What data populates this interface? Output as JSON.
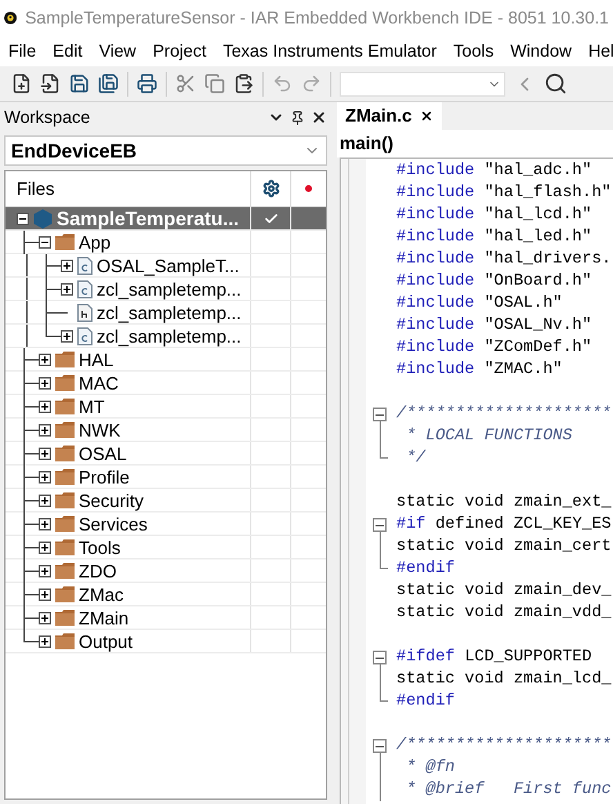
{
  "window": {
    "title": "SampleTemperatureSensor - IAR Embedded Workbench IDE - 8051 10.30.1"
  },
  "menu": [
    "File",
    "Edit",
    "View",
    "Project",
    "Texas Instruments Emulator",
    "Tools",
    "Window",
    "Hel"
  ],
  "workspace": {
    "title": "Workspace",
    "configuration": "EndDeviceEB",
    "files_header": "Files",
    "tree": [
      {
        "name": "SampleTemperatu...",
        "kind": "project",
        "expanded": true,
        "selected": true,
        "checked": true,
        "children": [
          {
            "name": "App",
            "kind": "folder",
            "expanded": true,
            "selected": false,
            "children": [
              {
                "name": "OSAL_SampleT...",
                "kind": "c-file",
                "expanded": false,
                "selected": false
              },
              {
                "name": "zcl_sampletemp...",
                "kind": "c-file",
                "expanded": false,
                "selected": false
              },
              {
                "name": "zcl_sampletemp...",
                "kind": "h-file",
                "selected": false
              },
              {
                "name": "zcl_sampletemp...",
                "kind": "c-file",
                "expanded": false,
                "selected": false
              }
            ]
          },
          {
            "name": "HAL",
            "kind": "folder",
            "expanded": false,
            "selected": false
          },
          {
            "name": "MAC",
            "kind": "folder",
            "expanded": false,
            "selected": false
          },
          {
            "name": "MT",
            "kind": "folder",
            "expanded": false,
            "selected": false
          },
          {
            "name": "NWK",
            "kind": "folder",
            "expanded": false,
            "selected": false
          },
          {
            "name": "OSAL",
            "kind": "folder",
            "expanded": false,
            "selected": false
          },
          {
            "name": "Profile",
            "kind": "folder",
            "expanded": false,
            "selected": false
          },
          {
            "name": "Security",
            "kind": "folder",
            "expanded": false,
            "selected": false
          },
          {
            "name": "Services",
            "kind": "folder",
            "expanded": false,
            "selected": false
          },
          {
            "name": "Tools",
            "kind": "folder",
            "expanded": false,
            "selected": false
          },
          {
            "name": "ZDO",
            "kind": "folder",
            "expanded": false,
            "selected": false
          },
          {
            "name": "ZMac",
            "kind": "folder",
            "expanded": false,
            "selected": false
          },
          {
            "name": "ZMain",
            "kind": "folder",
            "expanded": false,
            "selected": false
          },
          {
            "name": "Output",
            "kind": "folder",
            "expanded": false,
            "selected": false
          }
        ]
      }
    ]
  },
  "editor": {
    "tabs": [
      {
        "label": "ZMain.c",
        "selected": true
      }
    ],
    "function": "main()",
    "lines": [
      {
        "kind": "code",
        "segments": [
          {
            "kind": "keyword",
            "text": "#include"
          },
          {
            "kind": "plain",
            "text": " \"hal_adc.h\""
          }
        ]
      },
      {
        "kind": "code",
        "segments": [
          {
            "kind": "keyword",
            "text": "#include"
          },
          {
            "kind": "plain",
            "text": " \"hal_flash.h\""
          }
        ]
      },
      {
        "kind": "code",
        "segments": [
          {
            "kind": "keyword",
            "text": "#include"
          },
          {
            "kind": "plain",
            "text": " \"hal_lcd.h\""
          }
        ]
      },
      {
        "kind": "code",
        "segments": [
          {
            "kind": "keyword",
            "text": "#include"
          },
          {
            "kind": "plain",
            "text": " \"hal_led.h\""
          }
        ]
      },
      {
        "kind": "code",
        "segments": [
          {
            "kind": "keyword",
            "text": "#include"
          },
          {
            "kind": "plain",
            "text": " \"hal_drivers."
          }
        ]
      },
      {
        "kind": "code",
        "segments": [
          {
            "kind": "keyword",
            "text": "#include"
          },
          {
            "kind": "plain",
            "text": " \"OnBoard.h\""
          }
        ]
      },
      {
        "kind": "code",
        "segments": [
          {
            "kind": "keyword",
            "text": "#include"
          },
          {
            "kind": "plain",
            "text": " \"OSAL.h\""
          }
        ]
      },
      {
        "kind": "code",
        "segments": [
          {
            "kind": "keyword",
            "text": "#include"
          },
          {
            "kind": "plain",
            "text": " \"OSAL_Nv.h\""
          }
        ]
      },
      {
        "kind": "code",
        "segments": [
          {
            "kind": "keyword",
            "text": "#include"
          },
          {
            "kind": "plain",
            "text": " \"ZComDef.h\""
          }
        ]
      },
      {
        "kind": "code",
        "segments": [
          {
            "kind": "keyword",
            "text": "#include"
          },
          {
            "kind": "plain",
            "text": " \"ZMAC.h\""
          }
        ]
      },
      {
        "kind": "blank"
      },
      {
        "kind": "code",
        "fold_start": true,
        "segments": [
          {
            "kind": "comment",
            "text": "/*********************"
          }
        ]
      },
      {
        "kind": "code",
        "segments": [
          {
            "kind": "comment",
            "text": " * LOCAL FUNCTIONS"
          }
        ]
      },
      {
        "kind": "code",
        "fold_end": true,
        "segments": [
          {
            "kind": "comment",
            "text": " */"
          }
        ]
      },
      {
        "kind": "blank"
      },
      {
        "kind": "code",
        "segments": [
          {
            "kind": "plain",
            "text": "static void zmain_ext_"
          }
        ]
      },
      {
        "kind": "code",
        "fold_start": true,
        "segments": [
          {
            "kind": "keyword",
            "text": "#if"
          },
          {
            "kind": "plain",
            "text": " defined ZCL_KEY_ES"
          }
        ]
      },
      {
        "kind": "code",
        "segments": [
          {
            "kind": "plain",
            "text": "static void zmain_cert"
          }
        ]
      },
      {
        "kind": "code",
        "fold_end": true,
        "segments": [
          {
            "kind": "keyword",
            "text": "#endif"
          }
        ]
      },
      {
        "kind": "code",
        "segments": [
          {
            "kind": "plain",
            "text": "static void zmain_dev_"
          }
        ]
      },
      {
        "kind": "code",
        "segments": [
          {
            "kind": "plain",
            "text": "static void zmain_vdd_"
          }
        ]
      },
      {
        "kind": "blank"
      },
      {
        "kind": "code",
        "fold_start": true,
        "segments": [
          {
            "kind": "keyword",
            "text": "#ifdef"
          },
          {
            "kind": "plain",
            "text": " LCD_SUPPORTED"
          }
        ]
      },
      {
        "kind": "code",
        "segments": [
          {
            "kind": "plain",
            "text": "static void zmain_lcd_"
          }
        ]
      },
      {
        "kind": "code",
        "fold_end": true,
        "segments": [
          {
            "kind": "keyword",
            "text": "#endif"
          }
        ]
      },
      {
        "kind": "blank"
      },
      {
        "kind": "code",
        "fold_start": true,
        "segments": [
          {
            "kind": "comment",
            "text": "/*********************"
          }
        ]
      },
      {
        "kind": "code",
        "segments": [
          {
            "kind": "comment",
            "text": " * @fn"
          }
        ]
      },
      {
        "kind": "code",
        "segments": [
          {
            "kind": "comment",
            "text": " * @brief   First func"
          }
        ]
      }
    ]
  }
}
